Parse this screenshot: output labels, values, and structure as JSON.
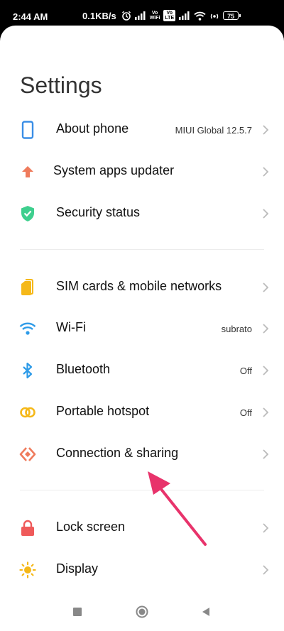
{
  "status_bar": {
    "time": "2:44 AM",
    "speed": "0.1KB/s",
    "vo_wifi_top": "Vo",
    "vo_wifi_bottom": "WiFi",
    "volte_top": "Vo",
    "volte_bottom": "LTE",
    "battery": "75"
  },
  "header": {
    "title": "Settings"
  },
  "sections": [
    [
      {
        "label": "About phone",
        "value": "MIUI Global 12.5.7",
        "icon": "phone-icon"
      },
      {
        "label": "System apps updater",
        "value": "",
        "icon": "up-arrow-icon"
      },
      {
        "label": "Security status",
        "value": "",
        "icon": "shield-check-icon"
      }
    ],
    [
      {
        "label": "SIM cards & mobile networks",
        "value": "",
        "icon": "sim-card-icon"
      },
      {
        "label": "Wi-Fi",
        "value": "subrato",
        "icon": "wifi-icon"
      },
      {
        "label": "Bluetooth",
        "value": "Off",
        "icon": "bluetooth-icon"
      },
      {
        "label": "Portable hotspot",
        "value": "Off",
        "icon": "hotspot-icon"
      },
      {
        "label": "Connection & sharing",
        "value": "",
        "icon": "connection-sharing-icon"
      }
    ],
    [
      {
        "label": "Lock screen",
        "value": "",
        "icon": "lock-icon"
      },
      {
        "label": "Display",
        "value": "",
        "icon": "sun-icon"
      }
    ]
  ],
  "nav_bar": {
    "buttons": [
      "recents-square-icon",
      "home-circle-icon",
      "back-triangle-icon"
    ]
  },
  "annotation": {
    "icon": "pointer-arrow",
    "color": "#e8336b"
  }
}
